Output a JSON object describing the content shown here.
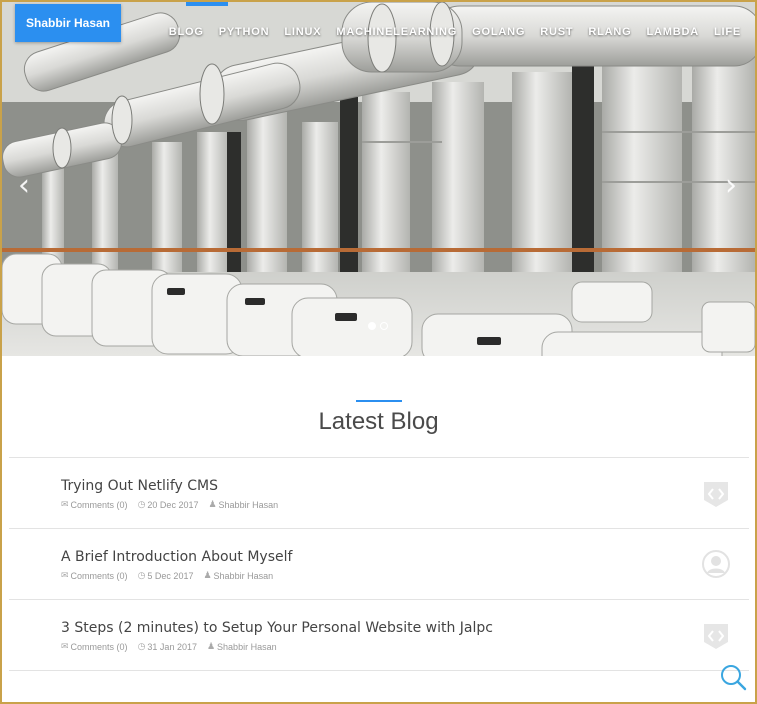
{
  "brand": {
    "name": "Shabbir Hasan"
  },
  "nav": {
    "items": [
      "BLOG",
      "PYTHON",
      "LINUX",
      "MACHINELEARNING",
      "GOLANG",
      "RUST",
      "RLANG",
      "LAMBDA",
      "LIFE"
    ]
  },
  "carousel": {
    "prev_icon": "chevron-left-icon",
    "next_icon": "chevron-right-icon",
    "slide_count": 2,
    "active_slide": 1
  },
  "section": {
    "title": "Latest Blog"
  },
  "posts": [
    {
      "title": "Trying Out Netlify CMS",
      "comments": "Comments (0)",
      "date": "20 Dec 2017",
      "author": "Shabbir Hasan",
      "icon": "code-shield-icon"
    },
    {
      "title": "A Brief Introduction About Myself",
      "comments": "Comments (0)",
      "date": "5 Dec 2017",
      "author": "Shabbir Hasan",
      "icon": "user-avatar-icon"
    },
    {
      "title": "3 Steps (2 minutes) to Setup Your Personal Website with Jalpc",
      "comments": "Comments (0)",
      "date": "31 Jan 2017",
      "author": "Shabbir Hasan",
      "icon": "code-shield-icon"
    }
  ],
  "colors": {
    "accent": "#2b8ff0",
    "text": "#444444",
    "meta": "#999999"
  }
}
